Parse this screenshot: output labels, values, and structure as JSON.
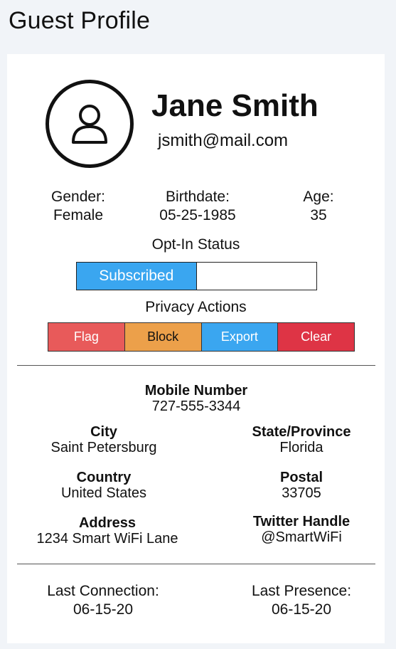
{
  "page": {
    "title": "Guest Profile"
  },
  "profile": {
    "name": "Jane Smith",
    "email": "jsmith@mail.com",
    "avatar_icon": "user-icon"
  },
  "stats": {
    "gender": {
      "label": "Gender:",
      "value": "Female"
    },
    "birthdate": {
      "label": "Birthdate:",
      "value": "05-25-1985"
    },
    "age": {
      "label": "Age:",
      "value": "35"
    }
  },
  "optin": {
    "title": "Opt-In Status",
    "status": "Subscribed",
    "fill_fraction": 0.5,
    "color": "#3aa6f0"
  },
  "privacy": {
    "title": "Privacy Actions",
    "actions": [
      {
        "label": "Flag",
        "color": "#e85a5a"
      },
      {
        "label": "Block",
        "color": "#eca04a"
      },
      {
        "label": "Export",
        "color": "#3aa6f0"
      },
      {
        "label": "Clear",
        "color": "#de3445"
      }
    ]
  },
  "details": {
    "mobile": {
      "label": "Mobile Number",
      "value": "727-555-3344"
    },
    "city": {
      "label": "City",
      "value": "Saint Petersburg"
    },
    "state": {
      "label": "State/Province",
      "value": "Florida"
    },
    "country": {
      "label": "Country",
      "value": "United States"
    },
    "postal": {
      "label": "Postal",
      "value": "33705"
    },
    "address": {
      "label": "Address",
      "value": "1234 Smart WiFi Lane"
    },
    "twitter": {
      "label": "Twitter Handle",
      "value": "@SmartWiFi"
    }
  },
  "footer": {
    "last_connection": {
      "label": "Last Connection:",
      "value": "06-15-20"
    },
    "last_presence": {
      "label": "Last Presence:",
      "value": "06-15-20"
    }
  }
}
